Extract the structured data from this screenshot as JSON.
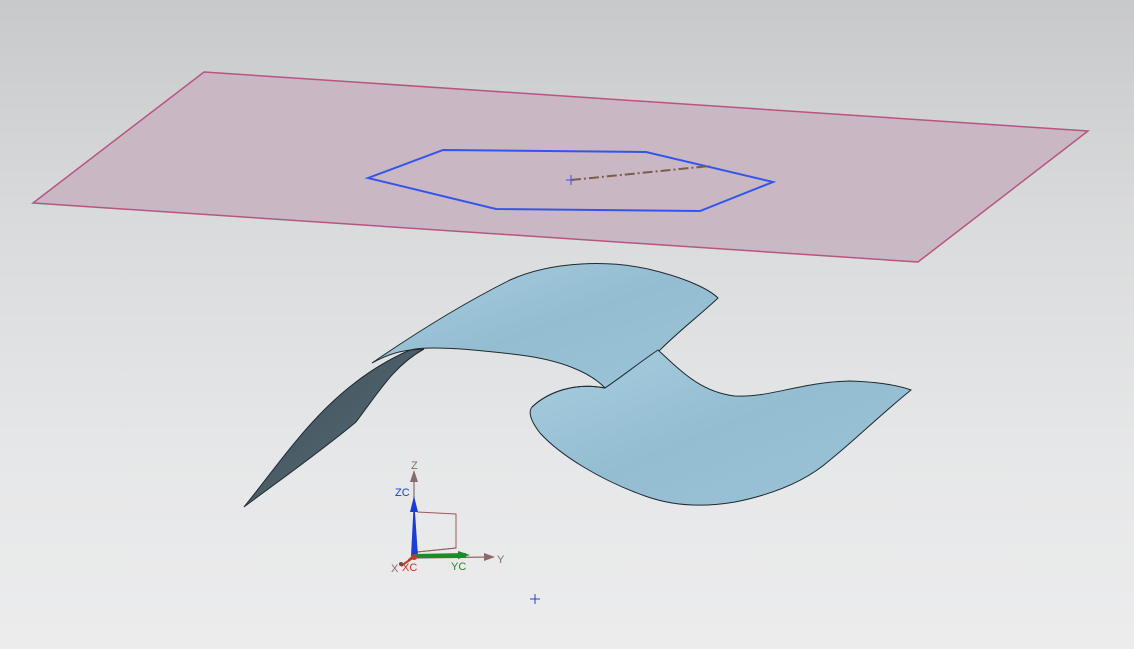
{
  "viewport": {
    "background_top": "#c8c9ca",
    "background_bottom": "#ececed"
  },
  "datum_plane": {
    "fill": "#c8b6c2",
    "edge_color": "#b8557e"
  },
  "sketch": {
    "hexagon_color": "#3355ee",
    "centerline_color": "#7a5e4a"
  },
  "surface": {
    "front_color": "#9dc3d6",
    "back_color": "#4c5f68",
    "edge_color": "#1f2a30"
  },
  "triad": {
    "labels": {
      "z": "Z",
      "zc": "ZC",
      "x": "X",
      "xc": "XC",
      "y": "Y",
      "yc": "YC"
    },
    "colors": {
      "z": "#1a3dd6",
      "x": "#c0392b",
      "y": "#1e8a2a",
      "frame": "#9a5a5a"
    }
  },
  "markers": {
    "view_center_color": "#2244cc"
  }
}
